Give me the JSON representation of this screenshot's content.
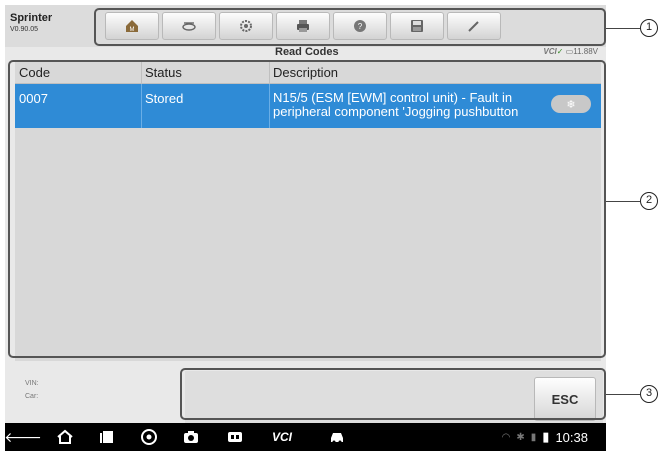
{
  "app": {
    "title": "Sprinter",
    "version": "V0.90.05"
  },
  "toolbar": {
    "items": [
      "home-icon",
      "vehicle-swap-icon",
      "settings-icon",
      "print-icon",
      "help-icon",
      "save-icon",
      "edit-icon"
    ]
  },
  "page": {
    "title": "Read Codes"
  },
  "vci": {
    "label": "VCI",
    "voltage": "11.88V"
  },
  "table": {
    "headers": {
      "code": "Code",
      "status": "Status",
      "description": "Description"
    },
    "rows": [
      {
        "code": "0007",
        "status": "Stored",
        "description_line1": "N15/5 (ESM [EWM] control unit) - Fault in",
        "description_line2": "peripheral component 'Jogging pushbutton"
      }
    ],
    "row_highlight": "#2f8bd6"
  },
  "footer": {
    "vin_label": "VIN:",
    "car_label": "Car:",
    "esc_label": "ESC"
  },
  "navbar": {
    "vci_label": "VCI",
    "time": "10:38"
  },
  "callouts": [
    "1",
    "2",
    "3"
  ]
}
